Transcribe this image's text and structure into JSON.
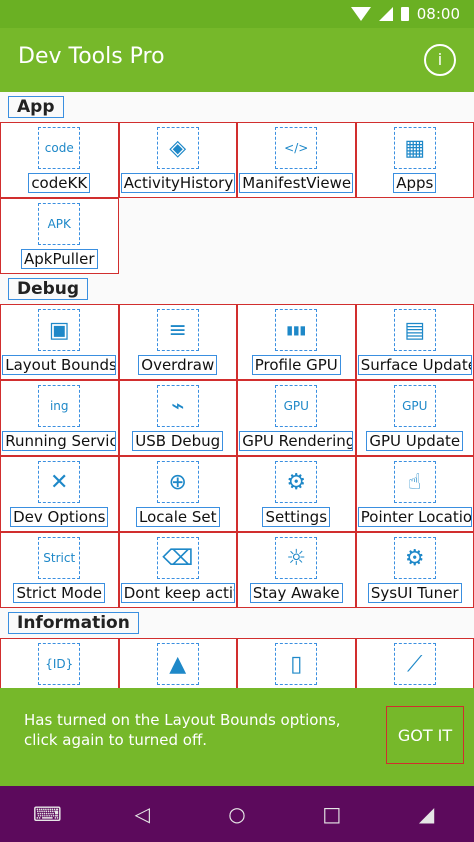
{
  "status_bar": {
    "time": "08:00"
  },
  "app_bar": {
    "title": "Dev Tools Pro",
    "info_icon": "i"
  },
  "sections": [
    {
      "title": "App",
      "items": [
        {
          "label": "codeKK",
          "icon": "code-icon",
          "glyph": "code"
        },
        {
          "label": "ActivityHistory",
          "icon": "layers-icon",
          "glyph": "◈"
        },
        {
          "label": "ManifestViewer",
          "icon": "xml-file-icon",
          "glyph": "</>"
        },
        {
          "label": "Apps",
          "icon": "grid-icon",
          "glyph": "▦"
        },
        {
          "label": "ApkPuller",
          "icon": "apk-file-icon",
          "glyph": "APK"
        }
      ]
    },
    {
      "title": "Debug",
      "items": [
        {
          "label": "Layout Bounds",
          "icon": "layout-icon",
          "glyph": "▣"
        },
        {
          "label": "Overdraw",
          "icon": "menu-lines-icon",
          "glyph": "≡"
        },
        {
          "label": "Profile GPU",
          "icon": "bar-chart-icon",
          "glyph": "▮▮▮"
        },
        {
          "label": "Surface Update",
          "icon": "chip-icon",
          "glyph": "▤"
        },
        {
          "label": "Running Service",
          "icon": "ing-icon",
          "glyph": "ing"
        },
        {
          "label": "USB Debug",
          "icon": "usb-icon",
          "glyph": "⌁"
        },
        {
          "label": "GPU Rendering",
          "icon": "gpu-icon",
          "glyph": "GPU"
        },
        {
          "label": "GPU Update",
          "icon": "gpu-chip-icon",
          "glyph": "GPU"
        },
        {
          "label": "Dev Options",
          "icon": "tools-icon",
          "glyph": "✕"
        },
        {
          "label": "Locale Set",
          "icon": "globe-icon",
          "glyph": "⊕"
        },
        {
          "label": "Settings",
          "icon": "gear-icon",
          "glyph": "⚙"
        },
        {
          "label": "Pointer Location",
          "icon": "pointer-icon",
          "glyph": "☝"
        },
        {
          "label": "Strict Mode",
          "icon": "strict-icon",
          "glyph": "Strict"
        },
        {
          "label": "Dont keep activi",
          "icon": "eraser-icon",
          "glyph": "⌫"
        },
        {
          "label": "Stay Awake",
          "icon": "bulb-icon",
          "glyph": "☼"
        },
        {
          "label": "SysUI Tuner",
          "icon": "gears-icon",
          "glyph": "⚙"
        }
      ]
    },
    {
      "title": "Information",
      "items": [
        {
          "label": "",
          "icon": "id-icon",
          "glyph": "{ID}"
        },
        {
          "label": "",
          "icon": "android-icon",
          "glyph": "▲"
        },
        {
          "label": "",
          "icon": "phone-icon",
          "glyph": "▯"
        },
        {
          "label": "",
          "icon": "ruler-icon",
          "glyph": "⟋"
        }
      ]
    }
  ],
  "snackbar": {
    "message": "Has turned on the Layout Bounds options, click again to turned off.",
    "action": "GOT IT"
  }
}
